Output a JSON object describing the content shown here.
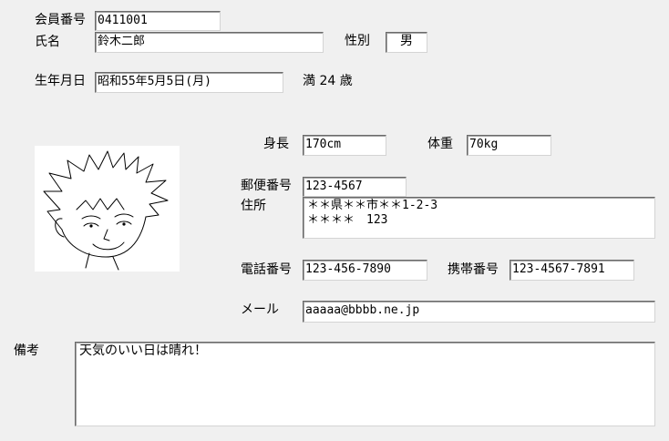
{
  "member": {
    "number_label": "会員番号",
    "number_value": "0411001",
    "name_label": "氏名",
    "name_value": "鈴木二郎",
    "gender_label": "性別",
    "gender_value": "男",
    "birthdate_label": "生年月日",
    "birthdate_value": "昭和55年5月5日(月)",
    "age_text": "満 24 歳"
  },
  "body": {
    "height_label": "身長",
    "height_value": "170cm",
    "weight_label": "体重",
    "weight_value": "70kg"
  },
  "address": {
    "postal_label": "郵便番号",
    "postal_value": "123-4567",
    "address_label": "住所",
    "address_value": "＊＊県＊＊市＊＊1-2-3\n＊＊＊＊　123"
  },
  "contact": {
    "phone_label": "電話番号",
    "phone_value": "123-456-7890",
    "mobile_label": "携帯番号",
    "mobile_value": "123-4567-7891",
    "email_label": "メール",
    "email_value": "aaaaa@bbbb.ne.jp"
  },
  "notes": {
    "label": "備考",
    "value": "天気のいい日は晴れ！"
  },
  "photo": {
    "icon": "cartoon-face-portrait"
  }
}
